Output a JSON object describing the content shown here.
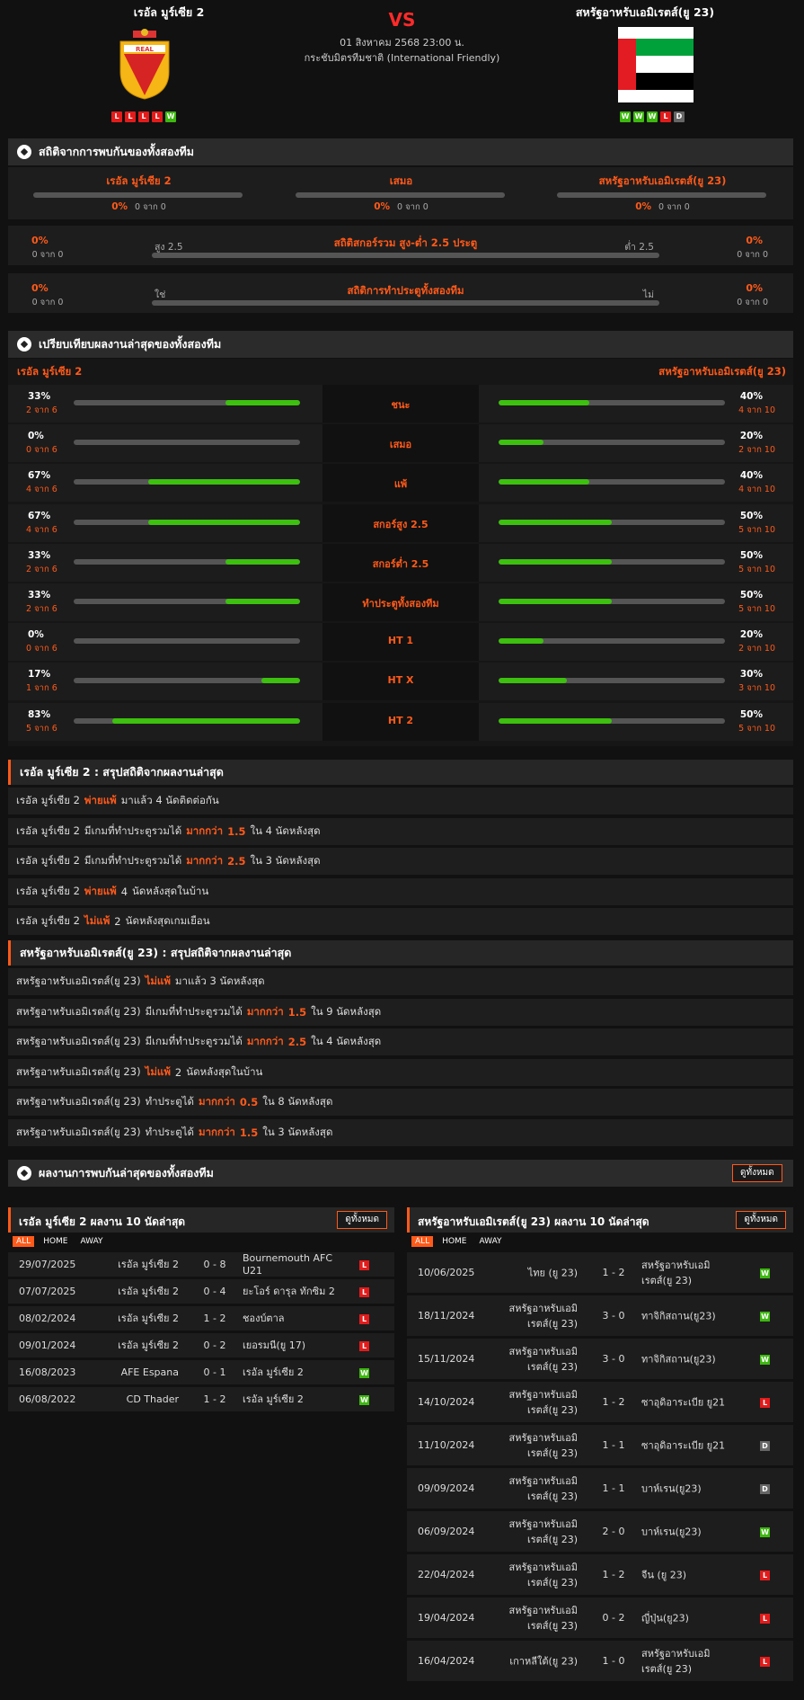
{
  "header": {
    "home_name": "เรอัล มูร์เซีย 2",
    "away_name": "สหรัฐอาหรับเอมิเรตส์(ยู 23)",
    "vs": "VS",
    "datetime": "01 สิงหาคม 2568 23:00 น.",
    "competition": "กระชับมิตรทีมชาติ (International Friendly)",
    "home_form": [
      "L",
      "L",
      "L",
      "L",
      "W"
    ],
    "away_form": [
      "W",
      "W",
      "W",
      "L",
      "D"
    ]
  },
  "h2h": {
    "title": "สถิติจากการพบกันของทั้งสองทีม",
    "cols": [
      {
        "label": "เรอัล มูร์เซีย 2",
        "pct": "0%",
        "sub": "0 จาก 0"
      },
      {
        "label": "เสมอ",
        "pct": "0%",
        "sub": "0 จาก 0"
      },
      {
        "label": "สหรัฐอาหรับเอมิเรตส์(ยู 23)",
        "pct": "0%",
        "sub": "0 จาก 0"
      }
    ],
    "ou": {
      "left_pct": "0%",
      "left_sub": "0 จาก 0",
      "over": "สูง 2.5",
      "title": "สถิติสกอร์รวม สูง-ต่ำ 2.5 ประตู",
      "under": "ต่ำ 2.5",
      "right_pct": "0%",
      "right_sub": "0 จาก 0"
    },
    "btts": {
      "left_pct": "0%",
      "left_sub": "0 จาก 0",
      "yes": "ใช่",
      "title": "สถิติการทำประตูทั้งสองทีม",
      "no": "ไม่",
      "right_pct": "0%",
      "right_sub": "0 จาก 0"
    }
  },
  "compare": {
    "title": "เปรียบเทียบผลงานล่าสุดของทั้งสองทีม",
    "home": "เรอัล มูร์เซีย 2",
    "away": "สหรัฐอาหรับเอมิเรตส์(ยู 23)",
    "rows": [
      {
        "label": "ชนะ",
        "hp": "33%",
        "hs": "2 จาก 6",
        "hv": 0.33,
        "ap": "40%",
        "as": "4 จาก 10",
        "av": 0.4
      },
      {
        "label": "เสมอ",
        "hp": "0%",
        "hs": "0 จาก 6",
        "hv": 0,
        "ap": "20%",
        "as": "2 จาก 10",
        "av": 0.2
      },
      {
        "label": "แพ้",
        "hp": "67%",
        "hs": "4 จาก 6",
        "hv": 0.67,
        "ap": "40%",
        "as": "4 จาก 10",
        "av": 0.4
      },
      {
        "label": "สกอร์สูง 2.5",
        "hp": "67%",
        "hs": "4 จาก 6",
        "hv": 0.67,
        "ap": "50%",
        "as": "5 จาก 10",
        "av": 0.5
      },
      {
        "label": "สกอร์ต่ำ 2.5",
        "hp": "33%",
        "hs": "2 จาก 6",
        "hv": 0.33,
        "ap": "50%",
        "as": "5 จาก 10",
        "av": 0.5
      },
      {
        "label": "ทำประตูทั้งสองทีม",
        "hp": "33%",
        "hs": "2 จาก 6",
        "hv": 0.33,
        "ap": "50%",
        "as": "5 จาก 10",
        "av": 0.5
      },
      {
        "label": "HT 1",
        "hp": "0%",
        "hs": "0 จาก 6",
        "hv": 0,
        "ap": "20%",
        "as": "2 จาก 10",
        "av": 0.2
      },
      {
        "label": "HT X",
        "hp": "17%",
        "hs": "1 จาก 6",
        "hv": 0.17,
        "ap": "30%",
        "as": "3 จาก 10",
        "av": 0.3
      },
      {
        "label": "HT 2",
        "hp": "83%",
        "hs": "5 จาก 6",
        "hv": 0.83,
        "ap": "50%",
        "as": "5 จาก 10",
        "av": 0.5
      }
    ]
  },
  "home_summary": {
    "title": "เรอัล มูร์เซีย 2 : สรุปสถิติจากผลงานล่าสุด",
    "rows": [
      [
        {
          "t": "เรอัล มูร์เซีย 2",
          "c": ""
        },
        {
          "t": "พ่ายแพ้",
          "c": "o"
        },
        {
          "t": "มาแล้ว 4 นัดติดต่อกัน",
          "c": ""
        }
      ],
      [
        {
          "t": "เรอัล มูร์เซีย 2",
          "c": ""
        },
        {
          "t": "มีเกมที่ทำประตูรวมได้",
          "c": ""
        },
        {
          "t": "มากกว่า",
          "c": "o"
        },
        {
          "t": "1.5",
          "c": "o"
        },
        {
          "t": "ใน 4 นัดหลังสุด",
          "c": ""
        }
      ],
      [
        {
          "t": "เรอัล มูร์เซีย 2",
          "c": ""
        },
        {
          "t": "มีเกมที่ทำประตูรวมได้",
          "c": ""
        },
        {
          "t": "มากกว่า",
          "c": "o"
        },
        {
          "t": "2.5",
          "c": "o"
        },
        {
          "t": "ใน 3 นัดหลังสุด",
          "c": ""
        }
      ],
      [
        {
          "t": "เรอัล มูร์เซีย 2",
          "c": ""
        },
        {
          "t": "พ่ายแพ้",
          "c": "o"
        },
        {
          "t": "4",
          "c": ""
        },
        {
          "t": "นัดหลังสุดในบ้าน",
          "c": ""
        }
      ],
      [
        {
          "t": "เรอัล มูร์เซีย 2",
          "c": ""
        },
        {
          "t": "ไม่แพ้",
          "c": "o"
        },
        {
          "t": "2",
          "c": ""
        },
        {
          "t": "นัดหลังสุดเกมเยือน",
          "c": ""
        }
      ]
    ]
  },
  "away_summary": {
    "title": "สหรัฐอาหรับเอมิเรตส์(ยู 23) : สรุปสถิติจากผลงานล่าสุด",
    "rows": [
      [
        {
          "t": "สหรัฐอาหรับเอมิเรตส์(ยู 23)",
          "c": ""
        },
        {
          "t": "ไม่แพ้",
          "c": "o"
        },
        {
          "t": "มาแล้ว 3 นัดหลังสุด",
          "c": ""
        }
      ],
      [
        {
          "t": "สหรัฐอาหรับเอมิเรตส์(ยู 23)",
          "c": ""
        },
        {
          "t": "มีเกมที่ทำประตูรวมได้",
          "c": ""
        },
        {
          "t": "มากกว่า",
          "c": "o"
        },
        {
          "t": "1.5",
          "c": "o"
        },
        {
          "t": "ใน 9 นัดหลังสุด",
          "c": ""
        }
      ],
      [
        {
          "t": "สหรัฐอาหรับเอมิเรตส์(ยู 23)",
          "c": ""
        },
        {
          "t": "มีเกมที่ทำประตูรวมได้",
          "c": ""
        },
        {
          "t": "มากกว่า",
          "c": "o"
        },
        {
          "t": "2.5",
          "c": "o"
        },
        {
          "t": "ใน 4 นัดหลังสุด",
          "c": ""
        }
      ],
      [
        {
          "t": "สหรัฐอาหรับเอมิเรตส์(ยู 23)",
          "c": ""
        },
        {
          "t": "ไม่แพ้",
          "c": "o"
        },
        {
          "t": "2",
          "c": ""
        },
        {
          "t": "นัดหลังสุดในบ้าน",
          "c": ""
        }
      ],
      [
        {
          "t": "สหรัฐอาหรับเอมิเรตส์(ยู 23)",
          "c": ""
        },
        {
          "t": "ทำประตูได้",
          "c": ""
        },
        {
          "t": "มากกว่า",
          "c": "o"
        },
        {
          "t": "0.5",
          "c": "o"
        },
        {
          "t": "ใน 8 นัดหลังสุด",
          "c": ""
        }
      ],
      [
        {
          "t": "สหรัฐอาหรับเอมิเรตส์(ยู 23)",
          "c": ""
        },
        {
          "t": "ทำประตูได้",
          "c": ""
        },
        {
          "t": "มากกว่า",
          "c": "o"
        },
        {
          "t": "1.5",
          "c": "o"
        },
        {
          "t": "ใน 3 นัดหลังสุด",
          "c": ""
        }
      ]
    ]
  },
  "recent": {
    "title": "ผลงานการพบกันล่าสุดของทั้งสองทีม",
    "view_all": "ดูทั้งหมด",
    "tabs": [
      "ALL",
      "HOME",
      "AWAY"
    ],
    "home_title": "เรอัล มูร์เซีย 2 ผลงาน 10 นัดล่าสุด",
    "away_title": "สหรัฐอาหรับเอมิเรตส์(ยู 23) ผลงาน 10 นัดล่าสุด",
    "home_matches": [
      {
        "date": "29/07/2025",
        "home": "เรอัล มูร์เซีย 2",
        "score": "0 - 8",
        "away": "Bournemouth AFC U21",
        "r": "L"
      },
      {
        "date": "07/07/2025",
        "home": "เรอัล มูร์เซีย 2",
        "score": "0 - 4",
        "away": "ยะโอร์ ดารุล ทักซิม 2",
        "r": "L"
      },
      {
        "date": "08/02/2024",
        "home": "เรอัล มูร์เซีย 2",
        "score": "1 - 2",
        "away": "ชองบ์ตาล",
        "r": "L"
      },
      {
        "date": "09/01/2024",
        "home": "เรอัล มูร์เซีย 2",
        "score": "0 - 2",
        "away": "เยอรมนี(ยู 17)",
        "r": "L"
      },
      {
        "date": "16/08/2023",
        "home": "AFE Espana",
        "score": "0 - 1",
        "away": "เรอัล มูร์เซีย 2",
        "r": "W"
      },
      {
        "date": "06/08/2022",
        "home": "CD Thader",
        "score": "1 - 2",
        "away": "เรอัล มูร์เซีย 2",
        "r": "W"
      }
    ],
    "away_matches": [
      {
        "date": "10/06/2025",
        "home": "ไทย (ยู 23)",
        "score": "1 - 2",
        "away": "สหรัฐอาหรับเอมิเรตส์(ยู 23)",
        "r": "W"
      },
      {
        "date": "18/11/2024",
        "home": "สหรัฐอาหรับเอมิเรตส์(ยู 23)",
        "score": "3 - 0",
        "away": "ทาจิกิสถาน(ยู23)",
        "r": "W"
      },
      {
        "date": "15/11/2024",
        "home": "สหรัฐอาหรับเอมิเรตส์(ยู 23)",
        "score": "3 - 0",
        "away": "ทาจิกิสถาน(ยู23)",
        "r": "W"
      },
      {
        "date": "14/10/2024",
        "home": "สหรัฐอาหรับเอมิเรตส์(ยู 23)",
        "score": "1 - 2",
        "away": "ซาอุดิอาระเบีย ยู21",
        "r": "L"
      },
      {
        "date": "11/10/2024",
        "home": "สหรัฐอาหรับเอมิเรตส์(ยู 23)",
        "score": "1 - 1",
        "away": "ซาอุดิอาระเบีย ยู21",
        "r": "D"
      },
      {
        "date": "09/09/2024",
        "home": "สหรัฐอาหรับเอมิเรตส์(ยู 23)",
        "score": "1 - 1",
        "away": "บาห์เรน(ยู23)",
        "r": "D"
      },
      {
        "date": "06/09/2024",
        "home": "สหรัฐอาหรับเอมิเรตส์(ยู 23)",
        "score": "2 - 0",
        "away": "บาห์เรน(ยู23)",
        "r": "W"
      },
      {
        "date": "22/04/2024",
        "home": "สหรัฐอาหรับเอมิเรตส์(ยู 23)",
        "score": "1 - 2",
        "away": "จีน (ยู 23)",
        "r": "L"
      },
      {
        "date": "19/04/2024",
        "home": "สหรัฐอาหรับเอมิเรตส์(ยู 23)",
        "score": "0 - 2",
        "away": "ญี่ปุ่น(ยู23)",
        "r": "L"
      },
      {
        "date": "16/04/2024",
        "home": "เกาหลีใต้(ยู 23)",
        "score": "1 - 0",
        "away": "สหรัฐอาหรับเอมิเรตส์(ยู 23)",
        "r": "L"
      }
    ]
  },
  "colors": {
    "accent": "#ff5a1a",
    "win": "#3cb80f",
    "loss": "#e31b1b",
    "draw": "#666666"
  }
}
